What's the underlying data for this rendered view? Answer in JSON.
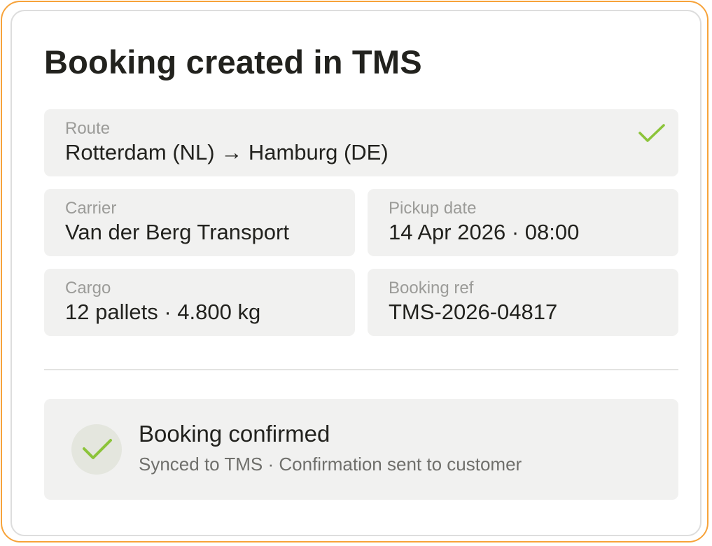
{
  "page": {
    "title": "Booking created in TMS"
  },
  "fields": {
    "route": {
      "label": "Route",
      "value": "Rotterdam (NL) → Hamburg (DE)"
    },
    "carrier": {
      "label": "Carrier",
      "value": "Van der Berg Transport"
    },
    "pickup_date": {
      "label": "Pickup date",
      "value": "14 Apr 2026 · 08:00"
    },
    "cargo": {
      "label": "Cargo",
      "value": "12 pallets · 4.800 kg"
    },
    "booking_ref": {
      "label": "Booking ref",
      "value": "TMS-2026-04817"
    }
  },
  "status": {
    "title": "Booking confirmed",
    "subtitle": "Synced to TMS · Confirmation sent to customer",
    "icon": "checkmark-icon"
  },
  "colors": {
    "accent_border": "#f7a33a",
    "check_green": "#8cc43a",
    "field_bg": "#f1f1f0",
    "text_primary": "#22221e",
    "text_label": "#9b9b98"
  }
}
